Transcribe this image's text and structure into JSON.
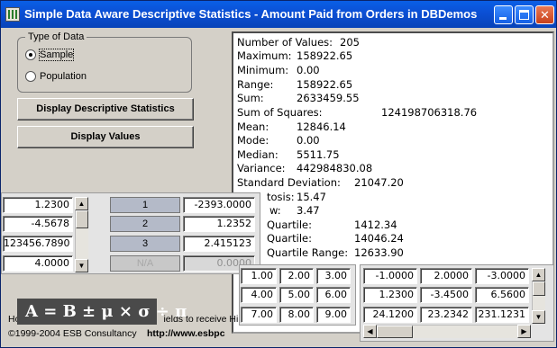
{
  "window": {
    "title": "Simple Data Aware Descriptive Statistics - Amount Paid from Orders in DBDemos",
    "minimize_label": "Minimize",
    "maximize_label": "Maximize",
    "close_glyph": "✕"
  },
  "data_type": {
    "legend": "Type of Data",
    "options": [
      {
        "label": "Sample",
        "selected": true
      },
      {
        "label": "Population",
        "selected": false
      }
    ]
  },
  "buttons": {
    "display_stats": "Display Descriptive Statistics",
    "display_values": "Display Values"
  },
  "stats": [
    {
      "label": "Number of Values:",
      "value": "205"
    },
    {
      "label": "Maximum:",
      "value": "158922.65"
    },
    {
      "label": "Minimum:",
      "value": "0.00"
    },
    {
      "label": "Range:",
      "value": "158922.65"
    },
    {
      "label": "Sum:",
      "value": "2633459.55"
    },
    {
      "label": "Sum of Squares:",
      "value": "124198706318.76"
    },
    {
      "label": "Mean:",
      "value": "12846.14"
    },
    {
      "label": "Mode:",
      "value": "0.00"
    },
    {
      "label": "Median:",
      "value": "5511.75"
    },
    {
      "label": "Variance:",
      "value": "442984830.08"
    },
    {
      "label": "Standard Deviation:",
      "value": "21047.20"
    },
    {
      "label": "tosis:",
      "value": "15.47"
    },
    {
      "label": "w:",
      "value": "3.47"
    },
    {
      "label": "Quartile:",
      "value": "1412.34"
    },
    {
      "label": "Quartile:",
      "value": "14046.24"
    },
    {
      "label": "Quartile Range:",
      "value": "12633.90"
    }
  ],
  "footer": {
    "hint": "Ho",
    "hint2": "ields to receive Hin",
    "copyright": "©1999-2004 ESB Consultancy",
    "url": "http://www.esbpc"
  },
  "left_grid": {
    "values": [
      "1.2300",
      "-4.5678",
      "123456.7890",
      "4.0000"
    ],
    "headers": [
      "1",
      "2",
      "3",
      "N/A"
    ],
    "results": [
      "-2393.0000",
      "1.2352",
      "2.415123",
      "0.0000"
    ]
  },
  "matrix_a": [
    [
      "1.00",
      "2.00",
      "3.00"
    ],
    [
      "4.00",
      "5.00",
      "6.00"
    ],
    [
      "7.00",
      "8.00",
      "9.00"
    ]
  ],
  "matrix_b": [
    [
      "-1.0000",
      "2.0000",
      "-3.0000"
    ],
    [
      "1.2300",
      "-3.4500",
      "6.5600"
    ],
    [
      "24.1200",
      "23.2342",
      "231.1231"
    ]
  ],
  "logo": {
    "text": "A = B ± μ × σ ÷ π"
  },
  "icons": {
    "up_arrow": "▲",
    "down_arrow": "▼",
    "left_arrow": "◀",
    "right_arrow": "▶"
  },
  "colors": {
    "titlebar": "#0b4fd4",
    "close_button": "#c8401a",
    "header_cell": "#b4bac8"
  }
}
